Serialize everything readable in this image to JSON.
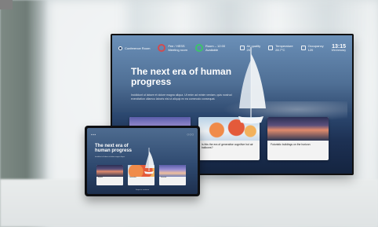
{
  "tv": {
    "status": {
      "location": "Conference Room",
      "booking_1": "Fee / HESS\nMeeting room",
      "booking_2": "Room – 12:00\nAvailable",
      "weather": "Air quality\n20",
      "temperature": "Temperature\n28.7°C",
      "occupancy": "Occupancy\n120"
    },
    "time": "13:15",
    "date": "Wednesday",
    "title": "The next era of human progress",
    "body": "Incididunt ut labore et dolore magna aliqua. Ut enim ad minim veniam, quis nostrud exercitation ullamco laboris nisi ut aliquip ex ea commodo consequat.",
    "cards": [
      {
        "caption": "",
        "image": "purple-sky"
      },
      {
        "caption": "Is this the era of generative cognitive hot air balloons?",
        "image": "hot-air-balloons"
      },
      {
        "caption": "Futuristic buildings on the horizon",
        "image": "buildings-sunset"
      }
    ]
  },
  "tablet": {
    "title": "The next era of human progress",
    "body": "Incididunt ut labore et dolore magna aliqua.",
    "cards": [
      {
        "caption": "Explore"
      },
      {
        "caption": "Generative"
      },
      {
        "caption": "Futuristic"
      }
    ],
    "caption": "Swipe to continue"
  },
  "colors": {
    "accent_red": "#d14b50",
    "accent_green": "#3cc36b"
  }
}
